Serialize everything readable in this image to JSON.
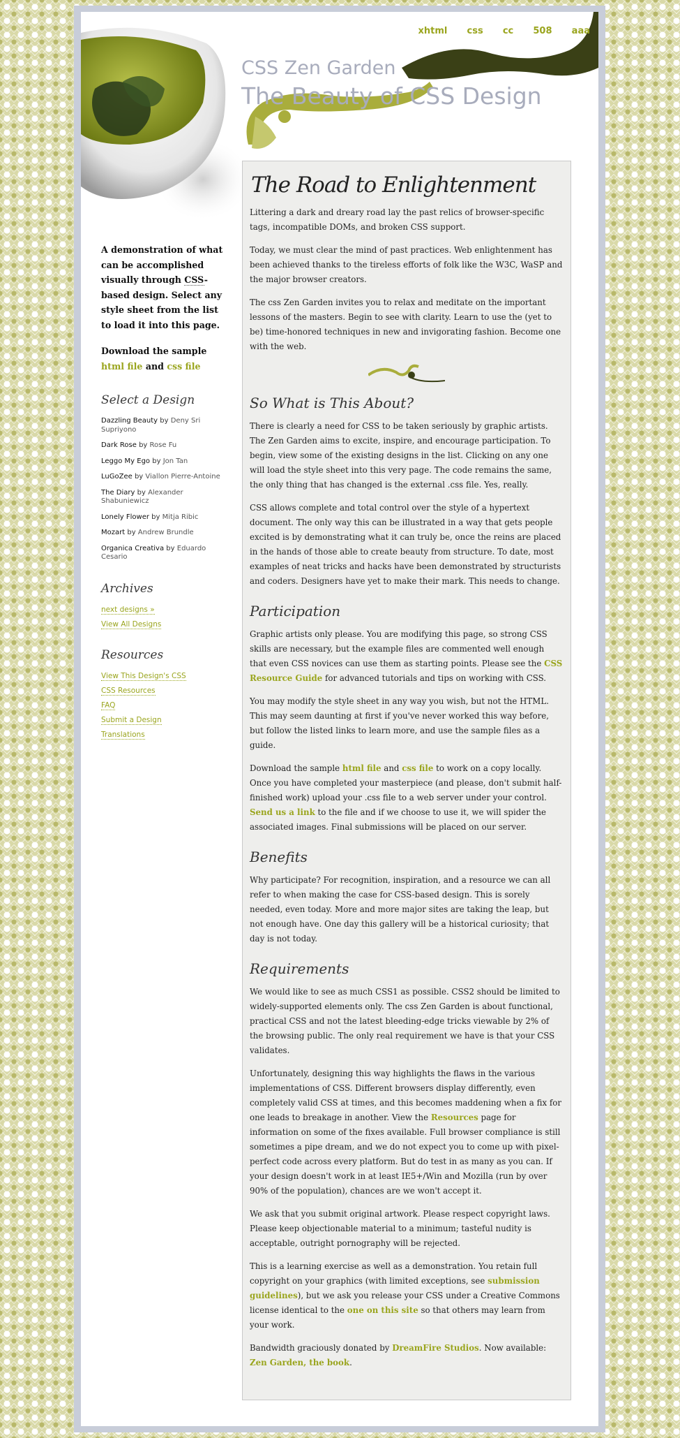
{
  "nav": [
    "xhtml",
    "css",
    "cc",
    "508",
    "aaa"
  ],
  "header": {
    "title": "CSS Zen Garden",
    "tagline": "The Beauty of CSS Design"
  },
  "sidebar": {
    "summary": {
      "line": "A demonstration of what can be accomplished visually through",
      "abbr": "CSS",
      "rest": "-based design. Select any style sheet from the list to load it into this page."
    },
    "download": {
      "prefix": "Download the sample",
      "html": "html file",
      "and": "and",
      "css": "css file"
    },
    "select_heading": "Select a Design",
    "designs": [
      {
        "name": "Dazzling Beauty",
        "by": "by",
        "author": "Deny Sri Supriyono"
      },
      {
        "name": "Dark Rose",
        "by": "by",
        "author": "Rose Fu"
      },
      {
        "name": "Leggo My Ego",
        "by": "by",
        "author": "Jon Tan"
      },
      {
        "name": "LuGoZee",
        "by": "by",
        "author": "Viallon Pierre-Antoine"
      },
      {
        "name": "The Diary",
        "by": "by",
        "author": "Alexander Shabuniewicz"
      },
      {
        "name": "Lonely Flower",
        "by": "by",
        "author": "Mitja Ribic"
      },
      {
        "name": "Mozart",
        "by": "by",
        "author": "Andrew Brundle"
      },
      {
        "name": "Organica Creativa",
        "by": "by",
        "author": "Eduardo Cesario"
      }
    ],
    "archives_heading": "Archives",
    "archives": [
      "next designs »",
      "View All Designs"
    ],
    "resources_heading": "Resources",
    "resources": [
      "View This Design's CSS",
      "CSS Resources",
      "FAQ",
      "Submit a Design",
      "Translations"
    ]
  },
  "main": {
    "intro_heading": "The Road to Enlightenment",
    "intro": [
      "Littering a dark and dreary road lay the past relics of browser-specific tags, incompatible DOMs, and broken CSS support.",
      "Today, we must clear the mind of past practices. Web enlightenment has been achieved thanks to the tireless efforts of folk like the W3C, WaSP and the major browser creators.",
      "The css Zen Garden invites you to relax and meditate on the important lessons of the masters. Begin to see with clarity. Learn to use the (yet to be) time-honored techniques in new and invigorating fashion. Become one with the web."
    ],
    "about_heading": "So What is This About?",
    "about": [
      "There is clearly a need for CSS to be taken seriously by graphic artists. The Zen Garden aims to excite, inspire, and encourage participation. To begin, view some of the existing designs in the list. Clicking on any one will load the style sheet into this very page. The code remains the same, the only thing that has changed is the external .css file. Yes, really.",
      "CSS allows complete and total control over the style of a hypertext document. The only way this can be illustrated in a way that gets people excited is by demonstrating what it can truly be, once the reins are placed in the hands of those able to create beauty from structure. To date, most examples of neat tricks and hacks have been demonstrated by structurists and coders. Designers have yet to make their mark. This needs to change."
    ],
    "participation_heading": "Participation",
    "participation": {
      "p1_before": "Graphic artists only please. You are modifying this page, so strong CSS skills are necessary, but the example files are commented well enough that even CSS novices can use them as starting points. Please see the",
      "p1_link": "CSS Resource Guide",
      "p1_after": "for advanced tutorials and tips on working with CSS.",
      "p2": "You may modify the style sheet in any way you wish, but not the HTML. This may seem daunting at first if you've never worked this way before, but follow the listed links to learn more, and use the sample files as a guide.",
      "p3_a": "Download the sample",
      "p3_html": "html file",
      "p3_and": "and",
      "p3_css": "css file",
      "p3_b": "to work on a copy locally. Once you have completed your masterpiece (and please, don't submit half-finished work) upload your .css file to a web server under your control.",
      "p3_link": "Send us a link",
      "p3_c": "to the file and if we choose to use it, we will spider the associated images. Final submissions will be placed on our server."
    },
    "benefits_heading": "Benefits",
    "benefits": "Why participate? For recognition, inspiration, and a resource we can all refer to when making the case for CSS-based design. This is sorely needed, even today. More and more major sites are taking the leap, but not enough have. One day this gallery will be a historical curiosity; that day is not today.",
    "requirements_heading": "Requirements",
    "requirements": {
      "p1": "We would like to see as much CSS1 as possible. CSS2 should be limited to widely-supported elements only. The css Zen Garden is about functional, practical CSS and not the latest bleeding-edge tricks viewable by 2% of the browsing public. The only real requirement we have is that your CSS validates.",
      "p2_a": "Unfortunately, designing this way highlights the flaws in the various implementations of CSS. Different browsers display differently, even completely valid CSS at times, and this becomes maddening when a fix for one leads to breakage in another. View the",
      "p2_link": "Resources",
      "p2_b": "page for information on some of the fixes available. Full browser compliance is still sometimes a pipe dream, and we do not expect you to come up with pixel-perfect code across every platform. But do test in as many as you can. If your design doesn't work in at least IE5+/Win and Mozilla (run by over 90% of the population), chances are we won't accept it.",
      "p3": "We ask that you submit original artwork. Please respect copyright laws. Please keep objectionable material to a minimum; tasteful nudity is acceptable, outright pornography will be rejected.",
      "p4_a": "This is a learning exercise as well as a demonstration. You retain full copyright on your graphics (with limited exceptions, see",
      "p4_link1": "submission guidelines",
      "p4_b": "), but we ask you release your CSS under a Creative Commons license identical to the",
      "p4_link2": "one on this site",
      "p4_c": "so that others may learn from your work.",
      "p5_a": "Bandwidth graciously donated by",
      "p5_link1": "DreamFire Studios",
      "p5_b": ". Now available:",
      "p5_link2": "Zen Garden, the book",
      "p5_c": "."
    }
  }
}
